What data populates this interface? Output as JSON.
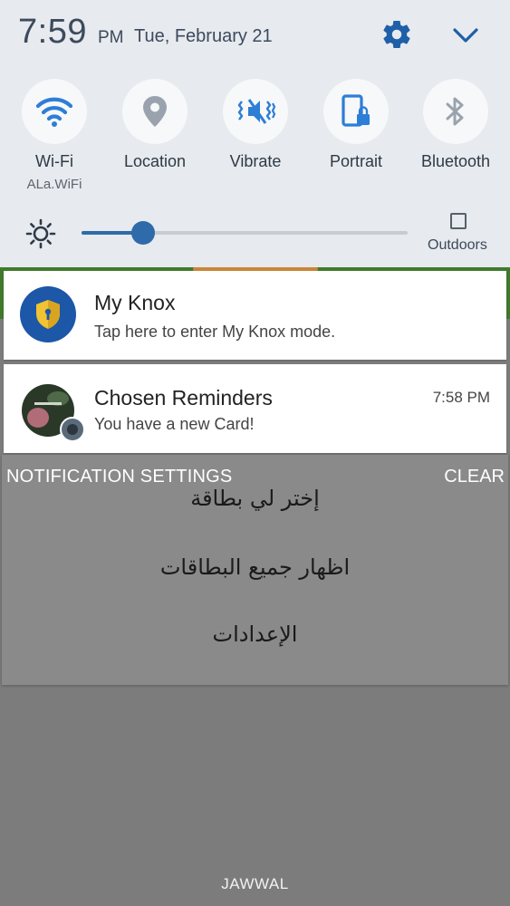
{
  "status": {
    "time": "7:59",
    "ampm": "PM",
    "date": "Tue, February 21"
  },
  "quick_tiles": [
    {
      "label": "Wi-Fi",
      "sublabel": "ALa.WiFi",
      "icon": "wifi-icon",
      "active": true
    },
    {
      "label": "Location",
      "icon": "location-pin-icon",
      "active": false
    },
    {
      "label": "Vibrate",
      "icon": "vibrate-icon",
      "active": true
    },
    {
      "label": "Portrait",
      "icon": "portrait-lock-icon",
      "active": true
    },
    {
      "label": "Bluetooth",
      "icon": "bluetooth-icon",
      "active": false
    }
  ],
  "brightness": {
    "level": 0.19,
    "outdoors_label": "Outdoors",
    "outdoors_checked": false
  },
  "notifications": [
    {
      "title": "My Knox",
      "text": "Tap here to enter My Knox mode.",
      "icon": "knox-shield-icon"
    },
    {
      "title": "Chosen Reminders",
      "text": "You have a new Card!",
      "time": "7:58 PM",
      "icon": "app-avatar-icon"
    }
  ],
  "actions": {
    "settings_label": "NOTIFICATION SETTINGS",
    "clear_label": "CLEAR"
  },
  "background_menu": [
    "إختر لي بطاقة",
    "اظهار جميع البطاقات",
    "الإعدادات"
  ],
  "carrier": "JAWWAL",
  "colors": {
    "accent": "#2f6aaa",
    "active_icon": "#2d7ed6",
    "inactive_icon": "#9aa3ad",
    "knox_blue": "#1d57a7"
  }
}
